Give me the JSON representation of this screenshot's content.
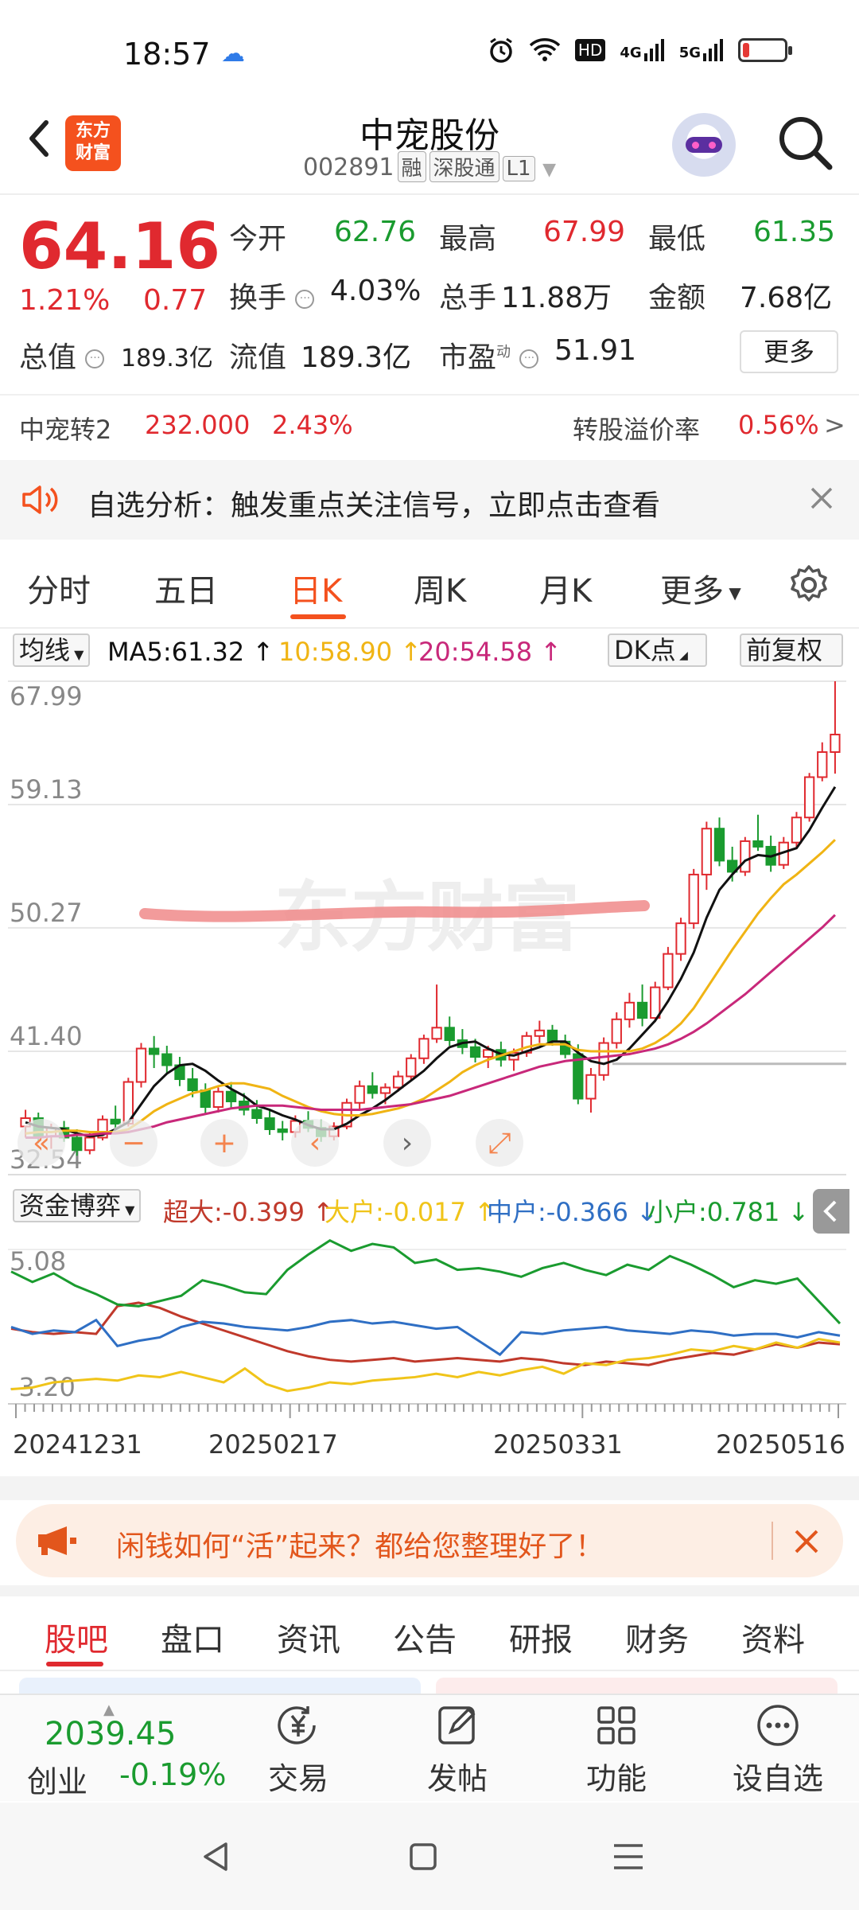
{
  "status_bar": {
    "time": "18:57",
    "network_labels": [
      "HD",
      "4G",
      "5G"
    ],
    "battery_fraction": 0.15,
    "battery_color": "#e53935"
  },
  "header": {
    "logo_line1": "东方",
    "logo_line2": "财富",
    "title": "中宠股份",
    "code": "002891",
    "tags": [
      "融",
      "深股通",
      "L1"
    ]
  },
  "quote": {
    "price": "64.16",
    "change_pct": "1.21%",
    "change_val": "0.77",
    "open_label": "今开",
    "open": "62.76",
    "high_label": "最高",
    "high": "67.99",
    "low_label": "最低",
    "low": "61.35",
    "turnover_label": "换手",
    "turnover": "4.03%",
    "volume_label": "总手",
    "volume": "11.88万",
    "amount_label": "金额",
    "amount": "7.68亿",
    "mktcap_label": "总值",
    "mktcap": "189.3亿",
    "float_label": "流值",
    "float": "189.3亿",
    "pe_label": "市盈",
    "pe_sup": "动",
    "pe": "51.91",
    "more_button": "更多"
  },
  "bond": {
    "name": "中宠转2",
    "price": "232.000",
    "pct": "2.43%",
    "premium_label": "转股溢价率",
    "premium": "0.56%",
    "arrow": ">"
  },
  "notice": {
    "text": "自选分析：触发重点关注信号，立即点击查看"
  },
  "tabs": [
    "分时",
    "五日",
    "日K",
    "周K",
    "月K",
    "更多"
  ],
  "ma_row": {
    "selector": "均线",
    "ma5": "MA5:61.32",
    "ma10": "10:58.90",
    "ma20": "20:54.58",
    "dk": "DK点",
    "adjust": "前复权"
  },
  "chart_data": {
    "type": "candlestick",
    "y_ticks": [
      "67.99",
      "59.13",
      "50.27",
      "41.40",
      "32.54"
    ],
    "ylim": [
      32.54,
      67.99
    ],
    "watermark": "东方财富",
    "candles": [
      [
        36.0,
        37.2,
        35.2,
        36.6
      ],
      [
        36.6,
        37.0,
        34.8,
        35.3
      ],
      [
        35.3,
        36.2,
        34.4,
        35.9
      ],
      [
        35.9,
        36.4,
        34.9,
        35.2
      ],
      [
        35.2,
        35.8,
        33.9,
        34.3
      ],
      [
        34.3,
        35.6,
        34.0,
        35.2
      ],
      [
        35.2,
        36.8,
        35.0,
        36.5
      ],
      [
        36.5,
        37.5,
        35.8,
        36.2
      ],
      [
        36.2,
        39.5,
        36.0,
        39.2
      ],
      [
        39.2,
        42.0,
        38.8,
        41.6
      ],
      [
        41.6,
        42.5,
        40.2,
        41.2
      ],
      [
        41.2,
        41.8,
        39.8,
        40.4
      ],
      [
        40.4,
        41.0,
        38.9,
        39.4
      ],
      [
        39.4,
        40.2,
        38.1,
        38.6
      ],
      [
        38.6,
        39.1,
        36.9,
        37.4
      ],
      [
        37.4,
        38.8,
        37.0,
        38.5
      ],
      [
        38.5,
        39.2,
        37.3,
        37.8
      ],
      [
        37.8,
        38.4,
        36.8,
        37.2
      ],
      [
        37.2,
        37.9,
        36.2,
        36.6
      ],
      [
        36.6,
        37.2,
        35.4,
        35.8
      ],
      [
        35.8,
        36.4,
        35.0,
        35.6
      ],
      [
        35.6,
        36.8,
        35.2,
        36.4
      ],
      [
        36.4,
        37.1,
        35.6,
        35.9
      ],
      [
        35.9,
        36.5,
        34.9,
        35.3
      ],
      [
        35.3,
        36.3,
        35.0,
        36.0
      ],
      [
        36.0,
        38.0,
        35.8,
        37.7
      ],
      [
        37.7,
        39.3,
        37.2,
        38.9
      ],
      [
        38.9,
        39.9,
        38.0,
        38.4
      ],
      [
        38.4,
        39.1,
        37.6,
        38.8
      ],
      [
        38.8,
        40.0,
        38.5,
        39.6
      ],
      [
        39.6,
        41.2,
        39.3,
        40.9
      ],
      [
        40.9,
        42.6,
        40.5,
        42.3
      ],
      [
        42.3,
        46.2,
        42.0,
        43.1
      ],
      [
        43.1,
        43.9,
        41.8,
        42.2
      ],
      [
        42.2,
        43.0,
        41.2,
        41.7
      ],
      [
        41.7,
        42.3,
        40.6,
        41.0
      ],
      [
        41.0,
        41.8,
        40.2,
        41.5
      ],
      [
        41.5,
        42.1,
        40.3,
        40.8
      ],
      [
        40.8,
        41.6,
        40.0,
        41.3
      ],
      [
        41.3,
        42.8,
        41.0,
        42.5
      ],
      [
        42.5,
        43.6,
        42.0,
        42.9
      ],
      [
        42.9,
        43.3,
        41.8,
        42.1
      ],
      [
        42.1,
        42.6,
        40.9,
        41.2
      ],
      [
        41.2,
        41.9,
        37.6,
        38.0
      ],
      [
        38.0,
        40.2,
        37.0,
        39.7
      ],
      [
        39.7,
        42.4,
        39.3,
        42.0
      ],
      [
        42.0,
        44.2,
        41.6,
        43.7
      ],
      [
        43.7,
        45.6,
        43.1,
        44.9
      ],
      [
        44.9,
        46.2,
        43.2,
        43.8
      ],
      [
        43.8,
        46.4,
        43.5,
        46.0
      ],
      [
        46.0,
        48.9,
        45.8,
        48.4
      ],
      [
        48.4,
        51.0,
        47.9,
        50.6
      ],
      [
        50.6,
        54.5,
        50.2,
        54.1
      ],
      [
        54.1,
        57.9,
        53.0,
        57.4
      ],
      [
        57.4,
        58.2,
        54.7,
        55.1
      ],
      [
        55.1,
        56.1,
        53.6,
        54.3
      ],
      [
        54.3,
        56.8,
        54.0,
        56.5
      ],
      [
        56.5,
        58.4,
        55.8,
        56.1
      ],
      [
        56.1,
        56.9,
        54.3,
        54.8
      ],
      [
        54.8,
        56.8,
        54.5,
        56.4
      ],
      [
        56.4,
        58.6,
        56.0,
        58.2
      ],
      [
        58.2,
        61.4,
        57.9,
        61.1
      ],
      [
        61.1,
        63.6,
        60.8,
        62.9
      ],
      [
        62.9,
        67.99,
        61.35,
        64.16
      ]
    ],
    "series": [
      {
        "name": "MA5",
        "color": "#111111",
        "values": [
          36.3,
          36.0,
          35.9,
          35.8,
          35.5,
          35.3,
          35.4,
          35.8,
          36.3,
          37.6,
          38.9,
          39.8,
          40.4,
          40.5,
          40.0,
          39.3,
          38.7,
          38.2,
          37.5,
          37.2,
          36.8,
          36.5,
          36.1,
          35.8,
          35.8,
          36.2,
          36.8,
          37.3,
          37.9,
          38.6,
          39.3,
          40.0,
          40.9,
          41.7,
          42.0,
          42.1,
          41.6,
          41.2,
          41.1,
          41.4,
          41.7,
          42.1,
          42.1,
          41.3,
          40.7,
          40.5,
          40.8,
          41.6,
          42.6,
          43.6,
          45.0,
          46.6,
          48.5,
          51.0,
          53.0,
          54.1,
          55.1,
          55.5,
          55.4,
          55.7,
          56.0,
          57.3,
          58.9,
          60.4
        ]
      },
      {
        "name": "MA10",
        "color": "#f0b414",
        "values": [
          35.5,
          35.6,
          35.6,
          35.7,
          35.7,
          35.6,
          35.6,
          35.6,
          35.8,
          36.4,
          37.1,
          37.6,
          38.0,
          38.4,
          38.6,
          38.9,
          39.1,
          39.1,
          38.9,
          38.7,
          38.2,
          37.8,
          37.4,
          37.1,
          36.9,
          36.8,
          36.8,
          36.9,
          37.1,
          37.3,
          37.6,
          38.0,
          38.6,
          39.2,
          39.9,
          40.4,
          40.8,
          41.1,
          41.4,
          41.7,
          41.9,
          41.9,
          41.9,
          41.5,
          41.4,
          41.4,
          41.4,
          41.4,
          41.6,
          42.0,
          42.6,
          43.4,
          44.5,
          45.9,
          47.3,
          48.7,
          50.0,
          51.3,
          52.4,
          53.4,
          54.1,
          54.9,
          55.7,
          56.6
        ]
      },
      {
        "name": "MA20",
        "color": "#c8287a",
        "values": [
          35.2,
          35.2,
          35.3,
          35.3,
          35.4,
          35.4,
          35.5,
          35.5,
          35.6,
          35.8,
          36.0,
          36.3,
          36.5,
          36.7,
          36.9,
          37.1,
          37.3,
          37.4,
          37.5,
          37.5,
          37.5,
          37.4,
          37.3,
          37.2,
          37.2,
          37.2,
          37.2,
          37.3,
          37.4,
          37.5,
          37.6,
          37.8,
          38.0,
          38.2,
          38.5,
          38.8,
          39.1,
          39.4,
          39.7,
          40.0,
          40.3,
          40.5,
          40.7,
          40.8,
          40.9,
          41.0,
          41.1,
          41.2,
          41.4,
          41.6,
          41.9,
          42.3,
          42.8,
          43.4,
          44.1,
          44.8,
          45.5,
          46.3,
          47.1,
          47.9,
          48.7,
          49.5,
          50.3,
          51.2
        ]
      }
    ]
  },
  "funds": {
    "selector": "资金博弈",
    "super_label": "超大:-0.399",
    "big_label": "大户:-0.017",
    "mid_label": "中户:-0.366",
    "small_label": "小户:0.781",
    "y_top": "5.08",
    "y_bottom": "-3.20",
    "series": [
      {
        "name": "超大",
        "color": "#c0392b",
        "values": [
          0.5,
          0.3,
          0.2,
          0.3,
          0.2,
          1.8,
          2.0,
          1.7,
          1.2,
          0.8,
          0.4,
          0.0,
          -0.4,
          -0.8,
          -1.1,
          -1.3,
          -1.4,
          -1.3,
          -1.2,
          -1.4,
          -1.3,
          -1.2,
          -1.3,
          -1.4,
          -1.2,
          -1.3,
          -1.5,
          -1.6,
          -1.4,
          -1.5,
          -1.6,
          -1.3,
          -1.1,
          -0.9,
          -1.0,
          -0.7,
          -0.4,
          -0.6,
          -0.3,
          -0.4
        ]
      },
      {
        "name": "大户",
        "color": "#f0c419",
        "values": [
          -3.0,
          -2.9,
          -2.6,
          -2.5,
          -2.4,
          -2.5,
          -2.2,
          -2.3,
          -2.0,
          -2.3,
          -2.6,
          -1.8,
          -2.7,
          -3.1,
          -2.9,
          -2.6,
          -2.7,
          -2.5,
          -2.4,
          -2.3,
          -2.1,
          -2.3,
          -2.0,
          -2.2,
          -1.9,
          -1.7,
          -2.1,
          -1.5,
          -1.6,
          -1.3,
          -1.2,
          -1.0,
          -0.7,
          -0.8,
          -0.5,
          -0.7,
          -0.3,
          -0.6,
          -0.1,
          -0.3
        ]
      },
      {
        "name": "中户",
        "color": "#2f6fc4",
        "values": [
          0.6,
          0.2,
          0.4,
          0.3,
          1.0,
          -0.5,
          -0.2,
          0.0,
          0.6,
          0.9,
          0.8,
          0.6,
          0.5,
          0.4,
          0.6,
          0.9,
          1.0,
          0.8,
          0.9,
          0.7,
          0.5,
          0.6,
          -0.2,
          -1.0,
          0.3,
          0.2,
          0.4,
          0.5,
          0.6,
          0.4,
          0.3,
          0.2,
          0.4,
          0.3,
          0.1,
          0.2,
          0.2,
          0.0,
          0.3,
          0.1
        ]
      },
      {
        "name": "小户",
        "color": "#1a9b2f",
        "values": [
          3.8,
          3.2,
          3.7,
          3.0,
          2.5,
          1.9,
          1.8,
          2.1,
          2.4,
          3.3,
          3.0,
          2.6,
          2.5,
          3.9,
          4.8,
          5.6,
          5.0,
          5.4,
          5.2,
          4.3,
          4.5,
          3.9,
          4.0,
          3.8,
          3.5,
          4.0,
          4.3,
          3.9,
          3.6,
          4.2,
          3.9,
          4.7,
          4.2,
          3.6,
          2.9,
          3.3,
          3.1,
          3.4,
          2.1,
          0.8
        ]
      }
    ]
  },
  "dates": [
    "20241231",
    "20250217",
    "20250331",
    "20250516"
  ],
  "promo": {
    "text": "闲钱如何“活”起来？都给您整理好了！"
  },
  "bottom_tabs": [
    "股吧",
    "盘口",
    "资讯",
    "公告",
    "研报",
    "财务",
    "资料"
  ],
  "toolbar": {
    "index_value": "2039.45",
    "index_name": "创业",
    "index_pct": "-0.19%",
    "trade": "交易",
    "post": "发帖",
    "functions": "功能",
    "watchlist": "设自选"
  },
  "colors": {
    "up": "#e0292f",
    "down": "#1a9b2f",
    "accent": "#f4511e"
  }
}
